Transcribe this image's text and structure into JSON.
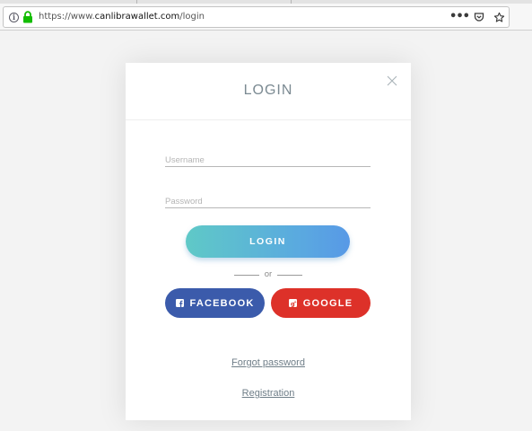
{
  "browser": {
    "url_prefix": "https://www.",
    "url_host": "canlibrawallet.com",
    "url_path": "/login",
    "menu_glyph": "•••"
  },
  "modal": {
    "title": "LOGIN",
    "username_placeholder": "Username",
    "password_placeholder": "Password",
    "login_label": "LOGIN",
    "or_label": "or",
    "facebook_label": "FACEBOOK",
    "google_label": "GOOGLE",
    "forgot_label": "Forgot password",
    "register_label": "Registration"
  },
  "icons": {
    "info": "info-icon",
    "lock": "lock-icon",
    "close": "close-icon",
    "facebook": "facebook-icon",
    "google": "google-icon"
  },
  "colors": {
    "login_gradient_start": "#5fc9c7",
    "login_gradient_end": "#5899e6",
    "facebook": "#3b5bab",
    "google": "#dd3129",
    "lock_green": "#12bc00"
  }
}
